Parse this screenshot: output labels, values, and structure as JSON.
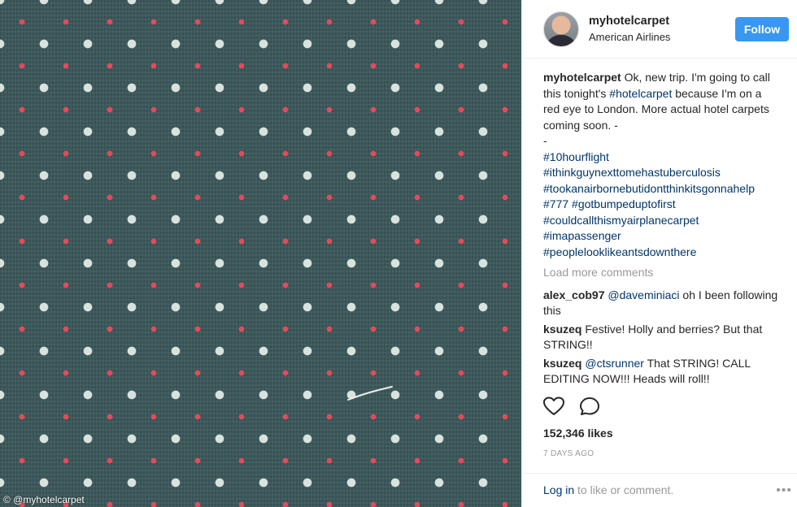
{
  "photo": {
    "watermark": "© @myhotelcarpet"
  },
  "header": {
    "username": "myhotelcarpet",
    "location": "American Airlines",
    "follow_label": "Follow"
  },
  "caption": {
    "username": "myhotelcarpet",
    "text_before": "Ok, new trip. I'm going to call this tonight's ",
    "hashtag_inline": "#hotelcarpet",
    "text_after": " because I'm on a red eye to London. More actual hotel carpets coming soon. -",
    "dash": "-",
    "tag_lines": [
      "#10hourflight",
      "#ithinkguynexttomehastuberculosis",
      "#tookanairbornebutidontthinkitsgonnahelp",
      "#777 #gotbumpeduptofirst",
      "#couldcallthismyairplanecarpet",
      "#imapassenger",
      "#peoplelooklikeantsdownthere"
    ]
  },
  "load_more": "Load more comments",
  "comments": [
    {
      "user": "alex_cob97",
      "mention": "@daveminiaci",
      "text": " oh I been following this"
    },
    {
      "user": "ksuzeq",
      "mention": "",
      "text": "Festive! Holly and berries? But that STRING!!"
    },
    {
      "user": "ksuzeq",
      "mention": "@ctsrunner",
      "text": " That STRING! CALL EDITING NOW!!! Heads will roll!!"
    }
  ],
  "actions": {
    "like_icon": "heart-icon",
    "comment_icon": "comment-icon"
  },
  "likes": "152,346 likes",
  "timestamp": "7 DAYS AGO",
  "footer": {
    "login_label": "Log in",
    "rest": " to like or comment.",
    "more": "•••"
  }
}
